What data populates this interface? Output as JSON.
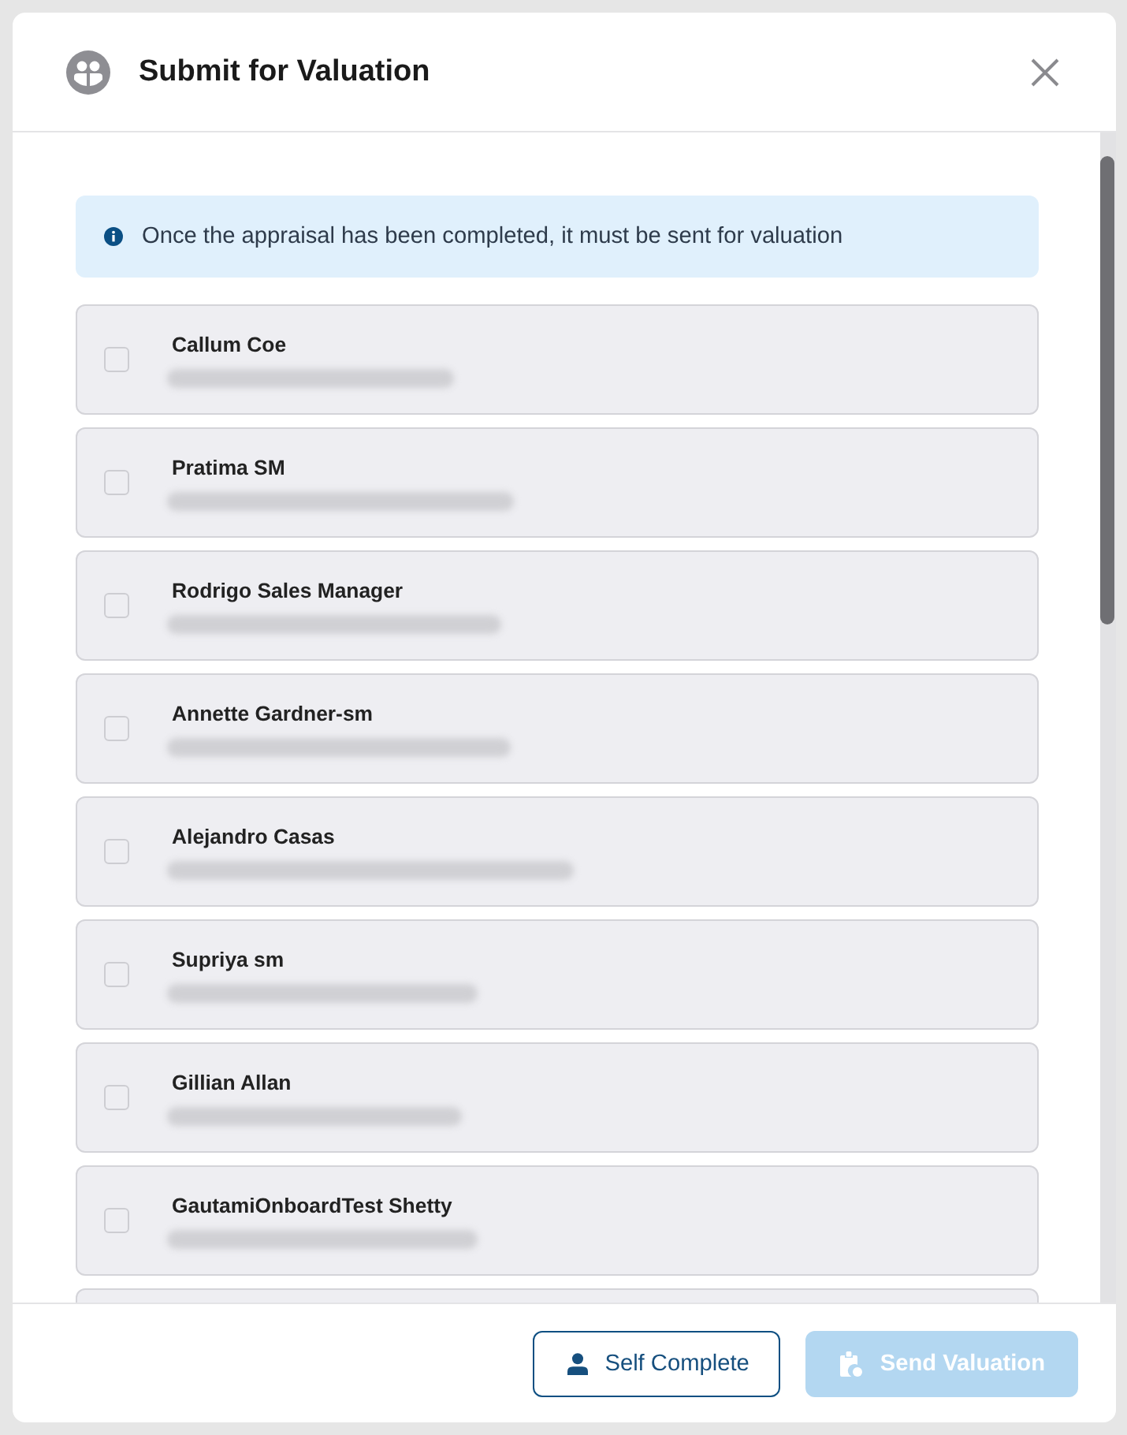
{
  "dialog": {
    "title": "Submit for Valuation"
  },
  "notice": {
    "text": "Once the appraisal has been completed, it must be sent for valuation"
  },
  "recipients": [
    {
      "name": "Callum Coe",
      "checked": false
    },
    {
      "name": "Pratima SM",
      "checked": false
    },
    {
      "name": "Rodrigo Sales Manager",
      "checked": false
    },
    {
      "name": "Annette Gardner-sm",
      "checked": false
    },
    {
      "name": "Alejandro Casas",
      "checked": false
    },
    {
      "name": "Supriya sm",
      "checked": false
    },
    {
      "name": "Gillian Allan",
      "checked": false
    },
    {
      "name": "GautamiOnboardTest Shetty",
      "checked": false
    }
  ],
  "list": {
    "more_below": true
  },
  "buttons": [
    {
      "label": "Self Complete",
      "kind": "outline",
      "disabled": false
    },
    {
      "label": "Send Valuation",
      "kind": "primary",
      "disabled": true
    }
  ]
}
